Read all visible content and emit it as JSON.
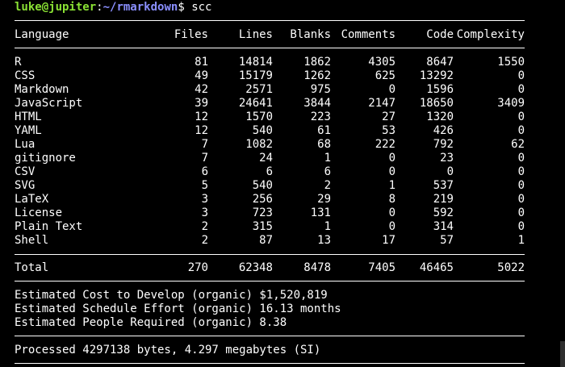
{
  "prompt": {
    "user_host": "luke@jupiter",
    "separator": ":",
    "cwd": "~/rmarkdown",
    "symbol": "$",
    "command": "scc"
  },
  "table": {
    "headers": {
      "language": "Language",
      "files": "Files",
      "lines": "Lines",
      "blanks": "Blanks",
      "comments": "Comments",
      "code": "Code",
      "complexity": "Complexity"
    },
    "rows": [
      {
        "language": "R",
        "files": "81",
        "lines": "14814",
        "blanks": "1862",
        "comments": "4305",
        "code": "8647",
        "complexity": "1550"
      },
      {
        "language": "CSS",
        "files": "49",
        "lines": "15179",
        "blanks": "1262",
        "comments": "625",
        "code": "13292",
        "complexity": "0"
      },
      {
        "language": "Markdown",
        "files": "42",
        "lines": "2571",
        "blanks": "975",
        "comments": "0",
        "code": "1596",
        "complexity": "0"
      },
      {
        "language": "JavaScript",
        "files": "39",
        "lines": "24641",
        "blanks": "3844",
        "comments": "2147",
        "code": "18650",
        "complexity": "3409"
      },
      {
        "language": "HTML",
        "files": "12",
        "lines": "1570",
        "blanks": "223",
        "comments": "27",
        "code": "1320",
        "complexity": "0"
      },
      {
        "language": "YAML",
        "files": "12",
        "lines": "540",
        "blanks": "61",
        "comments": "53",
        "code": "426",
        "complexity": "0"
      },
      {
        "language": "Lua",
        "files": "7",
        "lines": "1082",
        "blanks": "68",
        "comments": "222",
        "code": "792",
        "complexity": "62"
      },
      {
        "language": "gitignore",
        "files": "7",
        "lines": "24",
        "blanks": "1",
        "comments": "0",
        "code": "23",
        "complexity": "0"
      },
      {
        "language": "CSV",
        "files": "6",
        "lines": "6",
        "blanks": "6",
        "comments": "0",
        "code": "0",
        "complexity": "0"
      },
      {
        "language": "SVG",
        "files": "5",
        "lines": "540",
        "blanks": "2",
        "comments": "1",
        "code": "537",
        "complexity": "0"
      },
      {
        "language": "LaTeX",
        "files": "3",
        "lines": "256",
        "blanks": "29",
        "comments": "8",
        "code": "219",
        "complexity": "0"
      },
      {
        "language": "License",
        "files": "3",
        "lines": "723",
        "blanks": "131",
        "comments": "0",
        "code": "592",
        "complexity": "0"
      },
      {
        "language": "Plain Text",
        "files": "2",
        "lines": "315",
        "blanks": "1",
        "comments": "0",
        "code": "314",
        "complexity": "0"
      },
      {
        "language": "Shell",
        "files": "2",
        "lines": "87",
        "blanks": "13",
        "comments": "17",
        "code": "57",
        "complexity": "1"
      }
    ],
    "total": {
      "language": "Total",
      "files": "270",
      "lines": "62348",
      "blanks": "8478",
      "comments": "7405",
      "code": "46465",
      "complexity": "5022"
    }
  },
  "estimates": {
    "cost": "Estimated Cost to Develop (organic) $1,520,819",
    "schedule": "Estimated Schedule Effort (organic) 16.13 months",
    "people": "Estimated People Required (organic) 8.38"
  },
  "processed": "Processed 4297138 bytes, 4.297 megabytes (SI)",
  "colors": {
    "background": "#000000",
    "text": "#ffffff",
    "user_host": "#8ae234",
    "cwd": "#8a8fff"
  }
}
